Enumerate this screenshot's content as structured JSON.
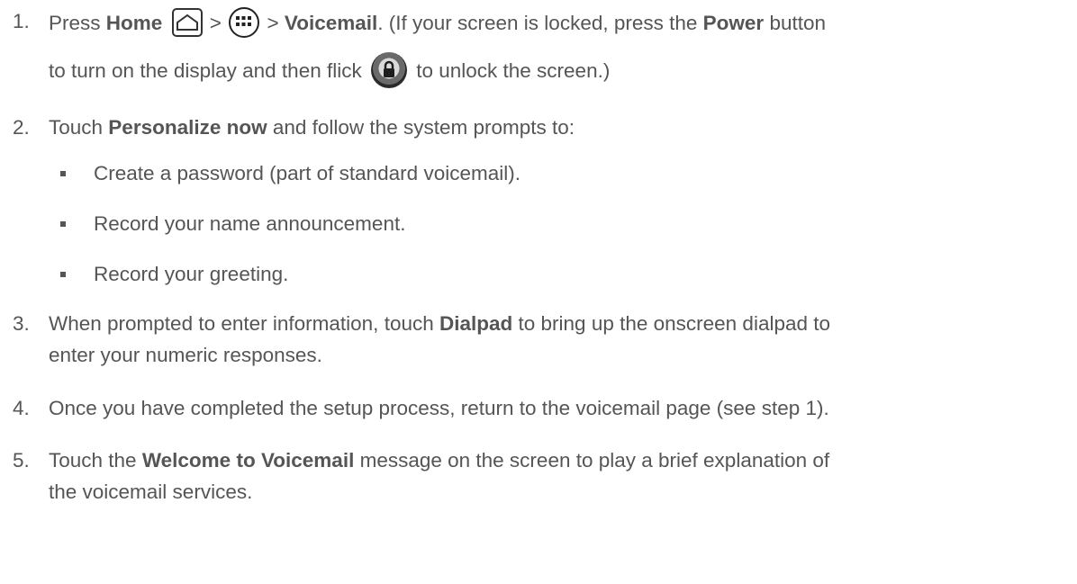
{
  "steps": [
    {
      "num": "1.",
      "parts": {
        "a": "Press ",
        "home": "Home",
        "gt1": " > ",
        "gt2": " > ",
        "voicemail": "Voicemail",
        "b": ". (If your screen is locked, press the ",
        "power": "Power",
        "c": " button",
        "d": "to turn on the display and then flick ",
        "e": " to unlock the screen.)"
      }
    },
    {
      "num": "2.",
      "parts": {
        "a": "Touch ",
        "personalize": "Personalize now",
        "b": " and follow the system prompts to:"
      },
      "bullets": [
        "Create a password (part of standard voicemail).",
        "Record your name announcement.",
        "Record your greeting."
      ]
    },
    {
      "num": "3.",
      "parts": {
        "a": "When prompted to enter information, touch ",
        "dialpad": "Dialpad",
        "b": " to bring up the onscreen dialpad to",
        "c": "enter your numeric responses."
      }
    },
    {
      "num": "4.",
      "parts": {
        "a": "Once you have completed the setup process, return to the voicemail page (see step 1)."
      }
    },
    {
      "num": "5.",
      "parts": {
        "a": "Touch the ",
        "welcome": "Welcome to Voicemail",
        "b": " message on the screen to play a brief explanation of",
        "c": "the voicemail services."
      }
    }
  ],
  "icons": {
    "home": "home-icon",
    "apps": "apps-grid-icon",
    "lock": "lock-icon"
  }
}
